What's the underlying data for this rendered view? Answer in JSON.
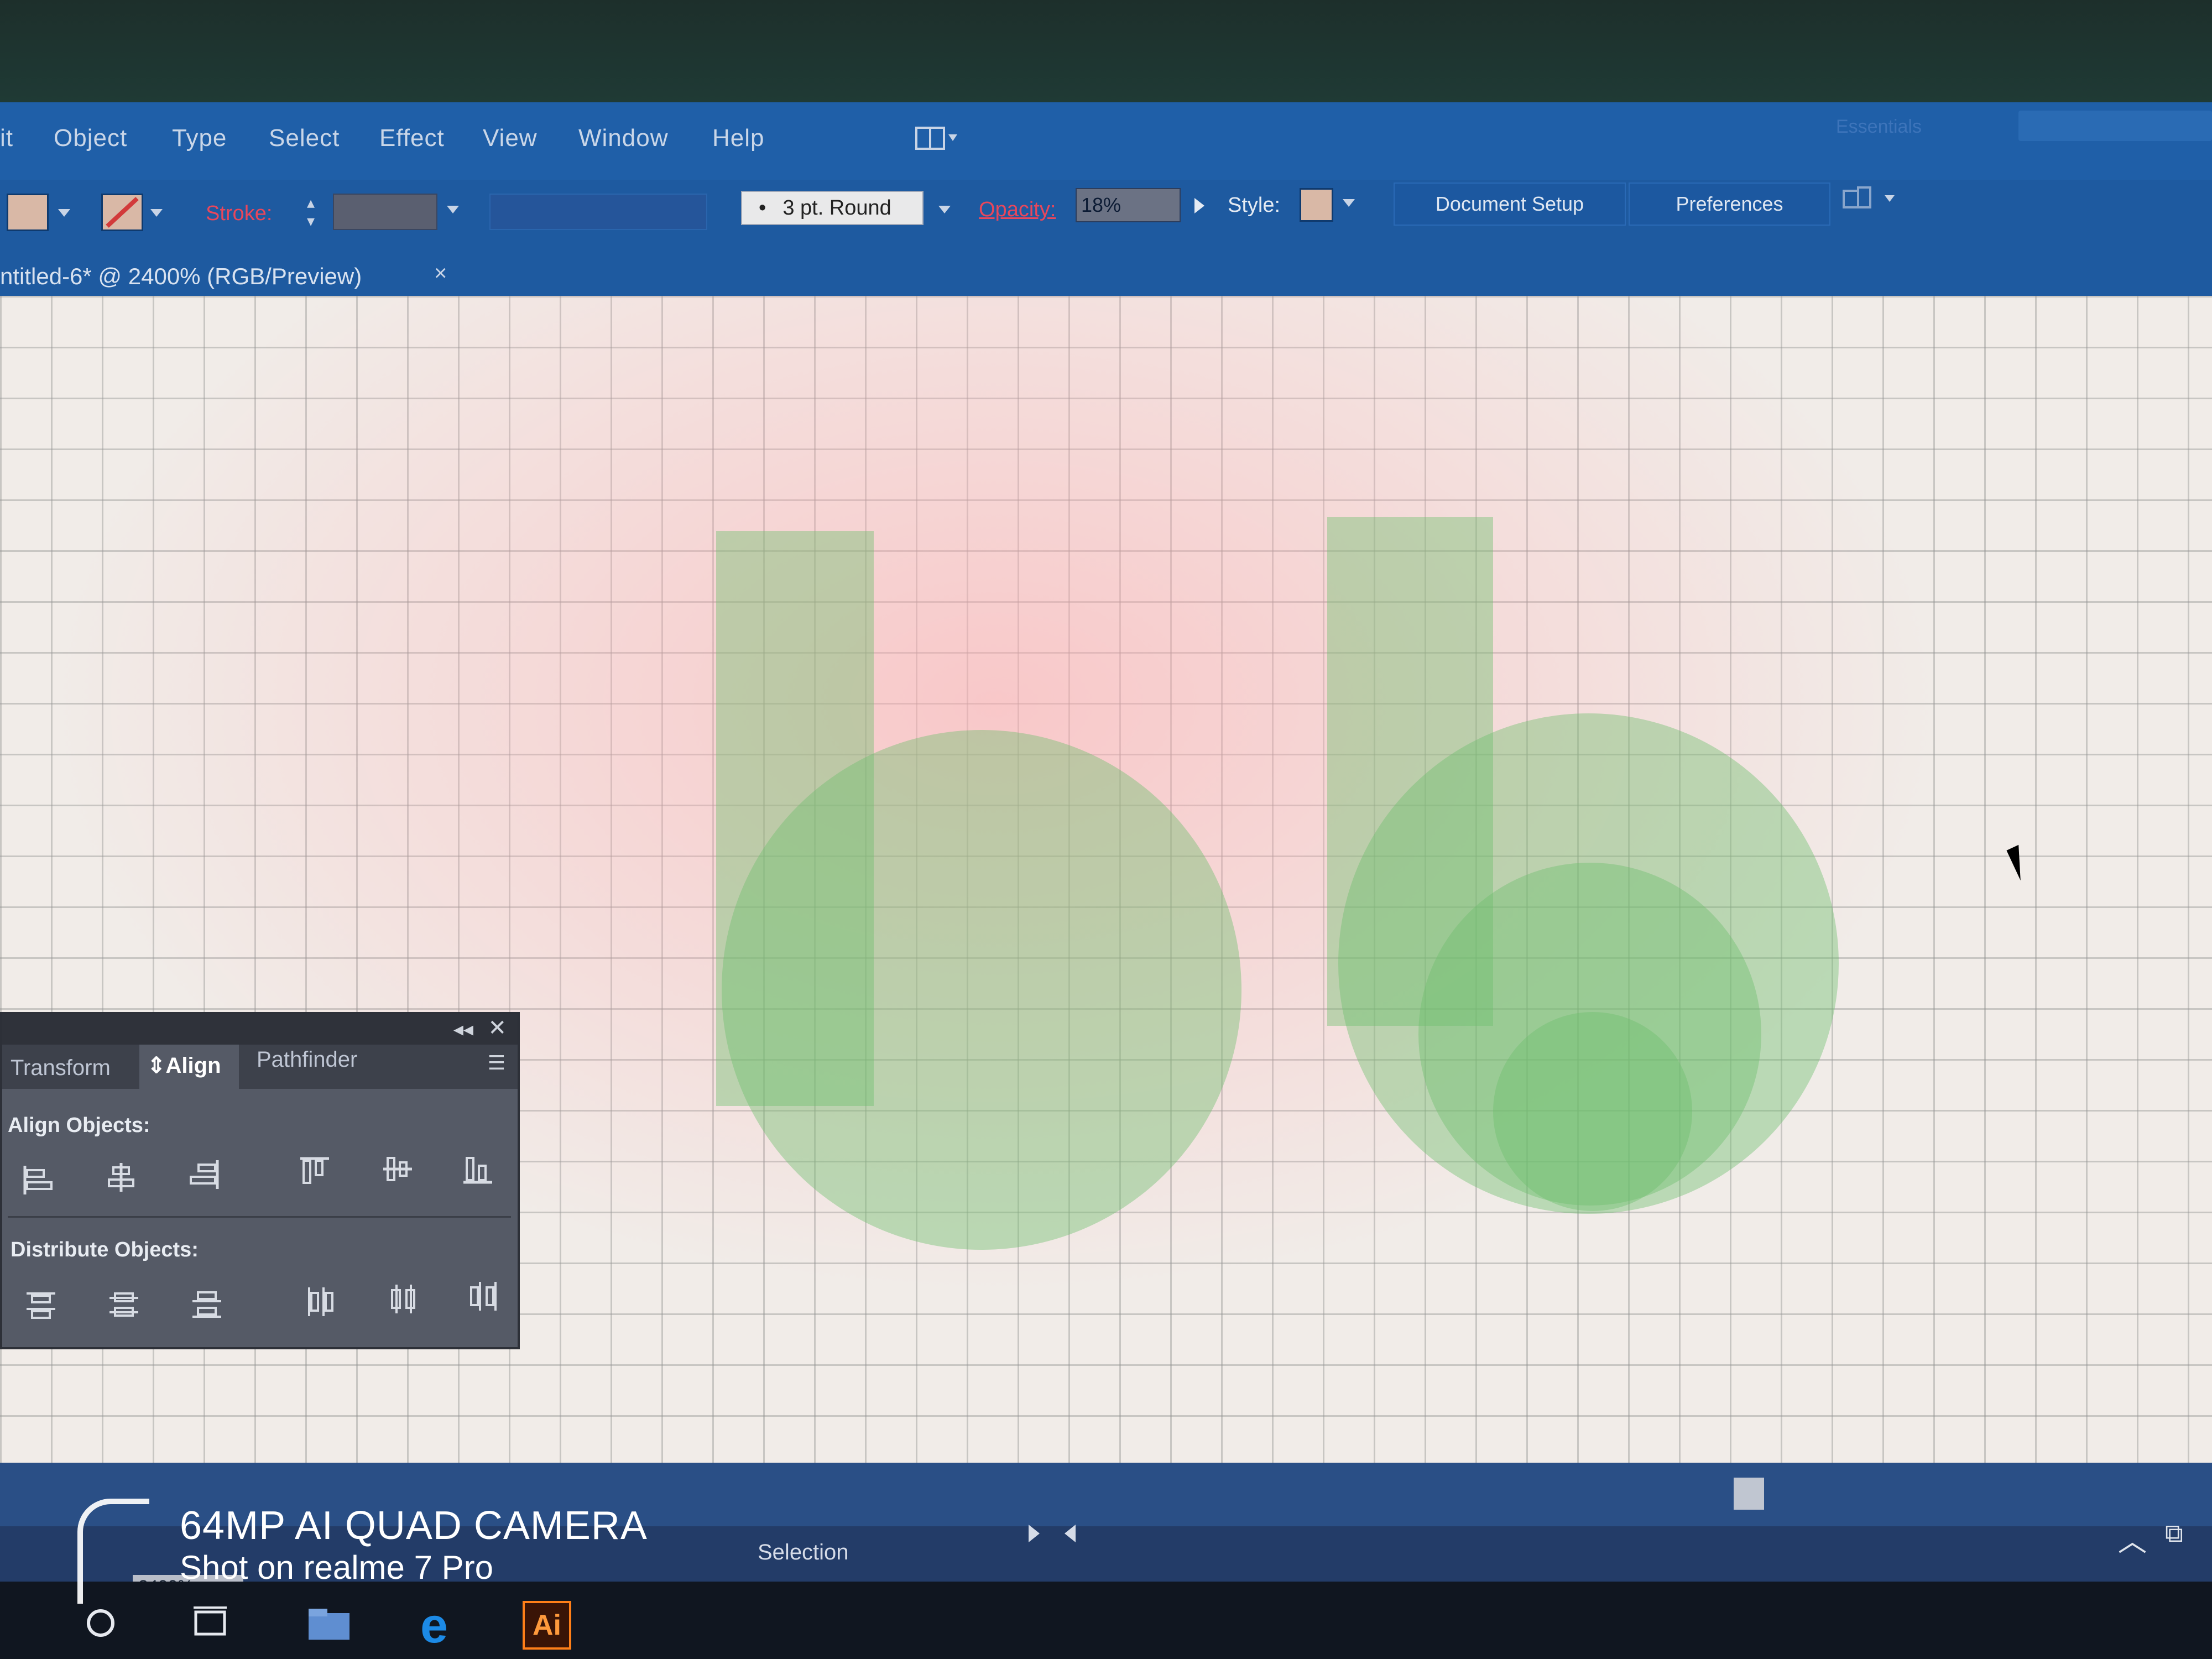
{
  "menu": {
    "items": [
      "it",
      "Object",
      "Type",
      "Select",
      "Effect",
      "View",
      "Window",
      "Help"
    ],
    "workspace": "Essentials"
  },
  "control_bar": {
    "stroke_label": "Stroke:",
    "brush": "3 pt. Round",
    "opacity_label": "Opacity:",
    "opacity_value": "18%",
    "style_label": "Style:",
    "document_setup": "Document Setup",
    "preferences": "Preferences",
    "fill_color": "#d9b8a6",
    "stroke_color": "#d23a3a"
  },
  "document": {
    "tab_title": "ntitled-6* @ 2400% (RGB/Preview)",
    "close": "×"
  },
  "align_panel": {
    "tabs": [
      "Transform",
      "Align",
      "Pathfinder"
    ],
    "active_tab": "Align",
    "align_title": "Align Objects:",
    "distribute_title": "Distribute Objects:",
    "align_icons": [
      "align-left-icon",
      "align-horizontal-center-icon",
      "align-right-icon",
      "align-top-icon",
      "align-vertical-center-icon",
      "align-bottom-icon"
    ],
    "distribute_icons": [
      "distribute-top-icon",
      "distribute-vertical-center-icon",
      "distribute-bottom-icon",
      "distribute-left-icon",
      "distribute-horizontal-center-icon",
      "distribute-right-icon"
    ]
  },
  "status": {
    "zoom": "2400%",
    "tool": "Selection"
  },
  "watermark": {
    "line1": "64MP AI QUAD CAMERA",
    "line2": "Shot on realme 7 Pro"
  },
  "artwork": {
    "shape_color": "#6ebe6e"
  }
}
